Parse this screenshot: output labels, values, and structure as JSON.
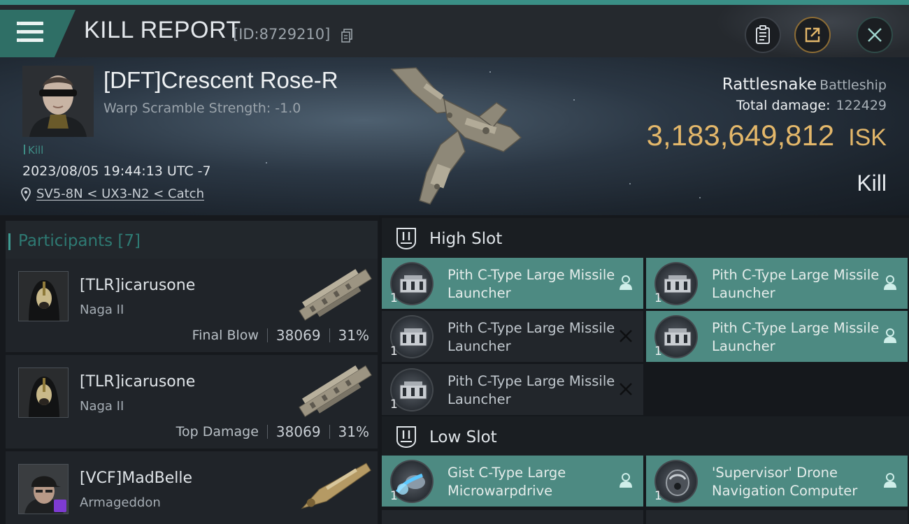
{
  "header": {
    "title": "KILL REPORT",
    "report_id": "[ID:8729210]"
  },
  "victim": {
    "name": "[DFT]Crescent Rose-R",
    "warp_scramble": "Warp Scramble Strength: -1.0",
    "kill_count": "Kill",
    "timestamp": "2023/08/05 19:44:13 UTC -7",
    "location": "SV5-8N < UX3-N2 < Catch"
  },
  "ship": {
    "name": "Rattlesnake",
    "class": "Battleship",
    "total_damage_label": "Total damage:",
    "total_damage": "122429",
    "isk_value": "3,183,649,812",
    "isk_unit": "ISK",
    "result": "Kill"
  },
  "participants": {
    "title": "Participants [7]",
    "rows": [
      {
        "name": "[TLR]icarusone",
        "ship": "Naga II",
        "label": "Final Blow",
        "damage": "38069",
        "percent": "31%"
      },
      {
        "name": "[TLR]icarusone",
        "ship": "Naga II",
        "label": "Top Damage",
        "damage": "38069",
        "percent": "31%"
      },
      {
        "name": "[VCF]MadBelle",
        "ship": "Armageddon",
        "label": "",
        "damage": "",
        "percent": ""
      }
    ]
  },
  "slots": {
    "high": {
      "label": "High Slot",
      "modules": [
        {
          "name": "Pith C-Type Large Missile Launcher",
          "qty": "1",
          "status": "fitted"
        },
        {
          "name": "Pith C-Type Large Missile Launcher",
          "qty": "1",
          "status": "fitted"
        },
        {
          "name": "Pith C-Type Large Missile Launcher",
          "qty": "1",
          "status": "destroyed"
        },
        {
          "name": "Pith C-Type Large Missile Launcher",
          "qty": "1",
          "status": "fitted"
        },
        {
          "name": "Pith C-Type Large Missile Launcher",
          "qty": "1",
          "status": "destroyed"
        }
      ]
    },
    "low": {
      "label": "Low Slot",
      "modules": [
        {
          "name": "Gist C-Type Large Microwarpdrive",
          "qty": "1",
          "status": "fitted"
        },
        {
          "name": "'Supervisor' Drone Navigation Computer",
          "qty": "1",
          "status": "fitted"
        }
      ]
    }
  },
  "colors": {
    "accent": "#3e9b92",
    "fitted": "#4d8a82",
    "isk": "#e3b76a"
  },
  "icons": [
    "menu-icon",
    "copy-icon",
    "notes-icon",
    "share-icon",
    "close-icon",
    "location-pin-icon",
    "high-slot-icon",
    "low-slot-icon",
    "pilot-icon",
    "destroyed-icon"
  ]
}
